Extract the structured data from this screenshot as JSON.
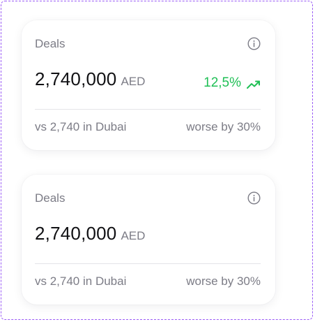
{
  "cards": [
    {
      "title": "Deals",
      "amount": "2,740,000",
      "currency": "AED",
      "change": "12,5%",
      "change_color": "#1fbf55",
      "change_icon": "trend-up-icon",
      "info_icon": "info-icon",
      "comparison": "vs 2,740 in Dubai",
      "comparison_result": "worse by 30%"
    },
    {
      "title": "Deals",
      "amount": "2,740,000",
      "currency": "AED",
      "info_icon": "info-icon",
      "comparison": "vs 2,740 in Dubai",
      "comparison_result": "worse by 30%"
    }
  ],
  "colors": {
    "frame_border": "#9b5cf6",
    "text_primary": "#111114",
    "text_secondary": "#7c7c86",
    "positive": "#1fbf55",
    "divider": "#e4e4e8"
  }
}
